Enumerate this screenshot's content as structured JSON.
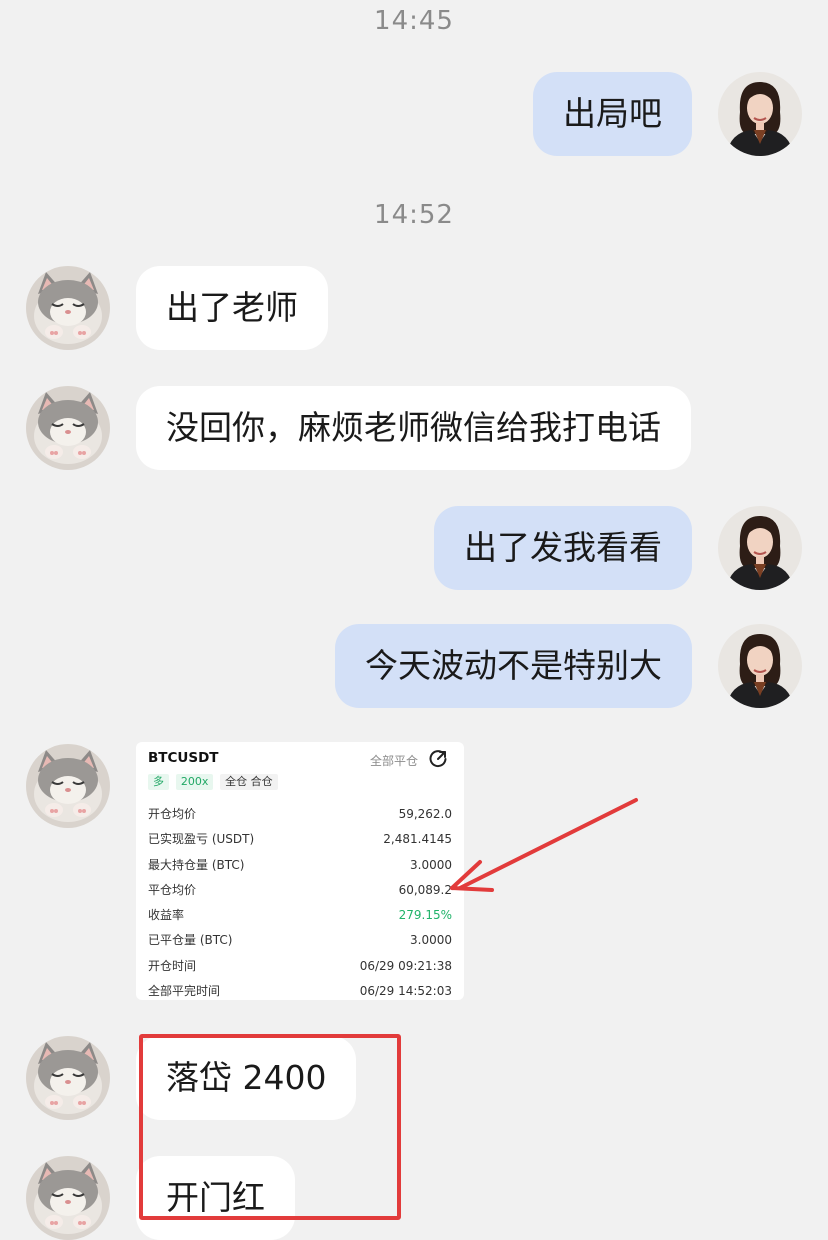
{
  "chat": {
    "timestamps": [
      "14:45",
      "14:52"
    ],
    "messages": [
      {
        "side": "out",
        "text": "出局吧"
      },
      {
        "side": "in",
        "text": "出了老师"
      },
      {
        "side": "in",
        "text": "没回你，麻烦老师微信给我打电话"
      },
      {
        "side": "out",
        "text": "出了发我看看"
      },
      {
        "side": "out",
        "text": "今天波动不是特别大"
      },
      {
        "side": "in",
        "text": "落岱 2400"
      },
      {
        "side": "in",
        "text": "开门红"
      }
    ]
  },
  "trade_card": {
    "symbol": "BTCUSDT",
    "close_all_label": "全部平仓",
    "share_icon": "share-icon",
    "tags": [
      "多",
      "200x",
      "全仓 合仓"
    ],
    "rows": [
      {
        "label": "开仓均价",
        "value": "59,262.0"
      },
      {
        "label": "已实现盈亏 (USDT)",
        "value": "2,481.4145"
      },
      {
        "label": "最大持仓量 (BTC)",
        "value": "3.0000"
      },
      {
        "label": "平仓均价",
        "value": "60,089.2"
      },
      {
        "label": "收益率",
        "value": "279.15%"
      },
      {
        "label": "已平仓量 (BTC)",
        "value": "3.0000"
      },
      {
        "label": "开仓时间",
        "value": "06/29 09:21:38"
      },
      {
        "label": "全部平完时间",
        "value": "06/29 14:52:03"
      }
    ]
  },
  "colors": {
    "background": "#f1f1f1",
    "incoming_bubble": "#ffffff",
    "outgoing_bubble": "#d3e0f7",
    "profit_green": "#21b36a",
    "annotation_red": "#e23b3b"
  },
  "avatars": {
    "self": "woman-portrait-avatar",
    "other": "kitten-avatar"
  }
}
